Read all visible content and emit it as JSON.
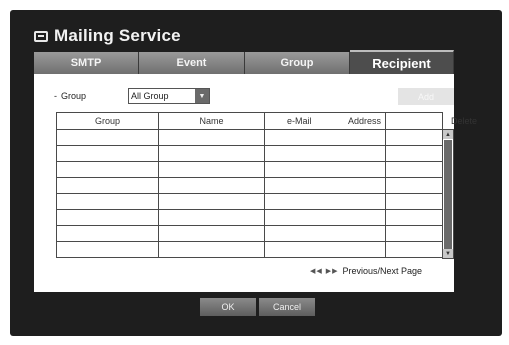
{
  "window": {
    "title": "Mailing Service",
    "icon": "mail-icon"
  },
  "tabs": [
    {
      "label": "SMTP",
      "active": false
    },
    {
      "label": "Event",
      "active": false
    },
    {
      "label": "Group",
      "active": false
    },
    {
      "label": "Recipient",
      "active": true
    }
  ],
  "filter": {
    "bullet": "-",
    "label": "Group",
    "selected_value": "All Group"
  },
  "toolbar": {
    "add_label": "Add"
  },
  "table": {
    "headers": {
      "group": "Group",
      "name": "Name",
      "email": "e-Mail",
      "address": "Address",
      "delete": "Delete"
    },
    "rows": [
      [
        "",
        "",
        "",
        ""
      ],
      [
        "",
        "",
        "",
        ""
      ],
      [
        "",
        "",
        "",
        ""
      ],
      [
        "",
        "",
        "",
        ""
      ],
      [
        "",
        "",
        "",
        ""
      ],
      [
        "",
        "",
        "",
        ""
      ],
      [
        "",
        "",
        "",
        ""
      ],
      [
        "",
        "",
        "",
        ""
      ]
    ]
  },
  "pager": {
    "icons": "◀◀ ▶▶",
    "label": "Previous/Next Page"
  },
  "footer": {
    "ok_label": "OK",
    "cancel_label": "Cancel"
  },
  "colors": {
    "frame": "#1e1e1e",
    "tab_active": "#4d4d4d",
    "tab_inactive": "#8a8a8a",
    "panel": "#ffffff"
  }
}
